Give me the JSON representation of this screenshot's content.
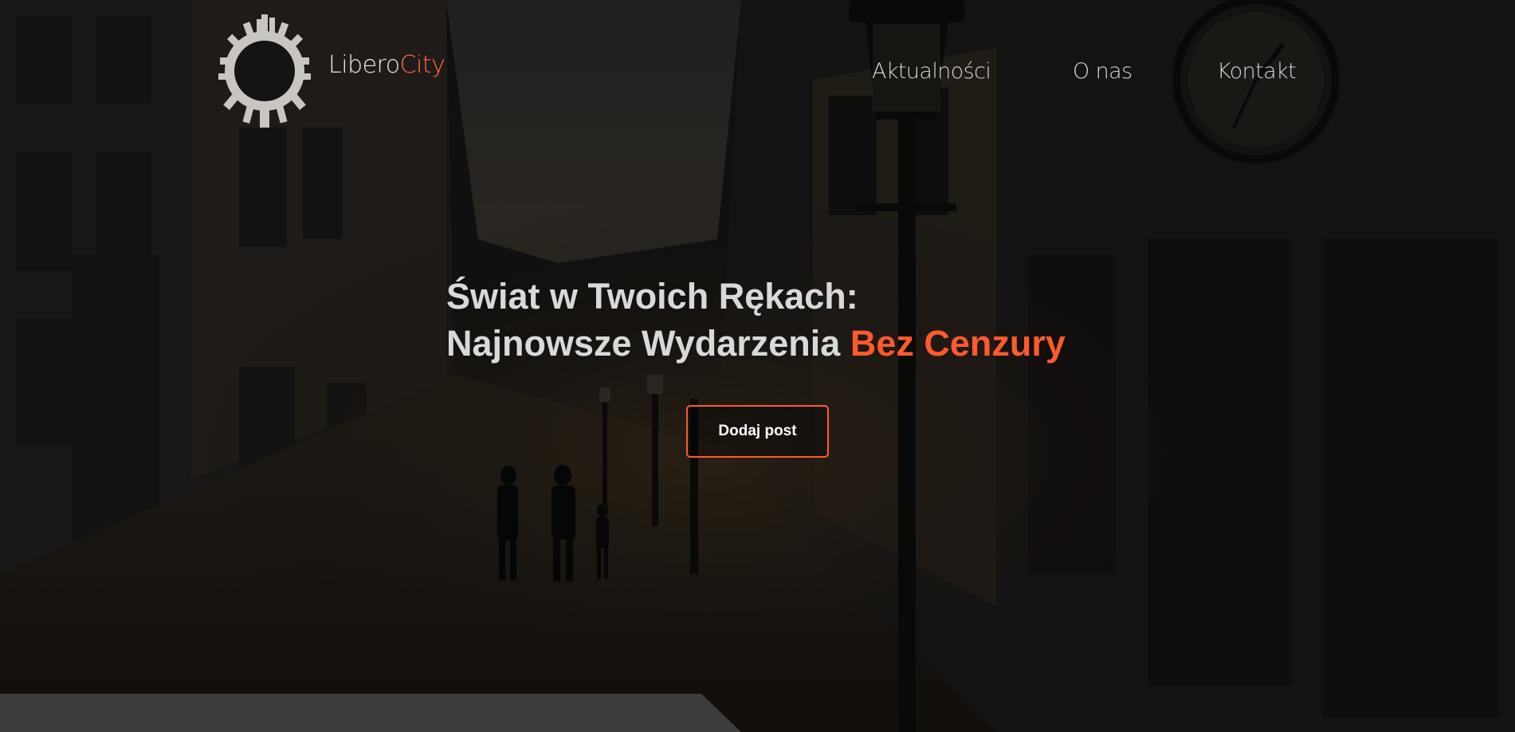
{
  "header": {
    "brand_first": "Libero",
    "brand_second": "City",
    "nav": [
      {
        "label": "Aktualności"
      },
      {
        "label": "O nas"
      },
      {
        "label": "Kontakt"
      }
    ]
  },
  "hero": {
    "headline_line1": "Świat w Twoich Rękach:",
    "headline_line2_plain": "Najnowsze Wydarzenia ",
    "headline_line2_accent": "Bez Cenzury",
    "cta_label": "Dodaj post"
  },
  "colors": {
    "accent": "#ff5a2c",
    "text": "#d9d9d9",
    "background": "#161412"
  },
  "icons": {
    "logo": "city-skyline-ring-icon"
  }
}
